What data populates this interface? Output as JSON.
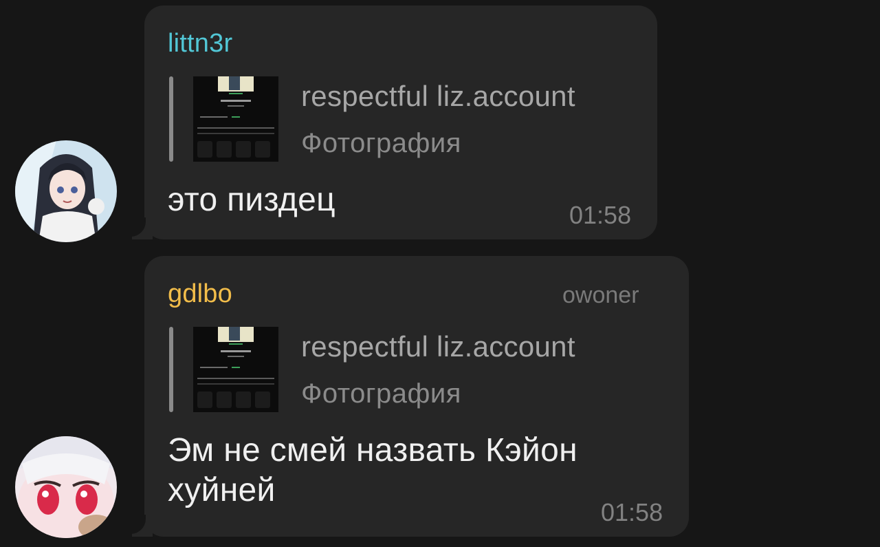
{
  "messages": [
    {
      "sender": "littn3r",
      "sender_color": "#52c7d6",
      "role": "",
      "reply": {
        "author": "respectful liz.account",
        "type": "Фотография"
      },
      "text": "это пиздец",
      "time": "01:58"
    },
    {
      "sender": "gdlbo",
      "sender_color": "#f2bd4a",
      "role": "owoner",
      "reply": {
        "author": "respectful liz.account",
        "type": "Фотография"
      },
      "text": "Эм не смей назвать Кэйон\nхуйней",
      "time": "01:58"
    }
  ]
}
